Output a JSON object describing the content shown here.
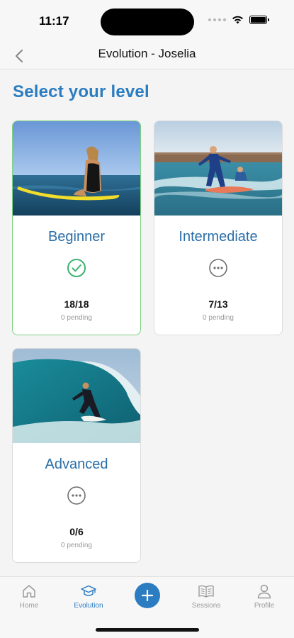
{
  "status_bar": {
    "time": "11:17"
  },
  "nav": {
    "title": "Evolution - Joselia",
    "back_icon": "chevron-left-icon"
  },
  "heading": "Select your level",
  "colors": {
    "accent": "#2b7cc1",
    "selected_border": "#7ed37e",
    "check_green": "#3cb371",
    "muted": "#9a9a9a"
  },
  "levels": [
    {
      "name": "Beginner",
      "progress": "18/18",
      "pending": "0 pending",
      "status_icon": "check-circle-icon",
      "selected": true,
      "completed_fraction": 1.0
    },
    {
      "name": "Intermediate",
      "progress": "7/13",
      "pending": "0 pending",
      "status_icon": "ellipsis-circle-icon",
      "selected": false,
      "completed_fraction": 0.54
    },
    {
      "name": "Advanced",
      "progress": "0/6",
      "pending": "0 pending",
      "status_icon": "ellipsis-circle-icon",
      "selected": false,
      "completed_fraction": 0.0
    }
  ],
  "tabs": [
    {
      "label": "Home",
      "icon": "home-icon",
      "active": false
    },
    {
      "label": "Evolution",
      "icon": "graduation-cap-icon",
      "active": true
    },
    {
      "label": "",
      "icon": "plus-icon",
      "active": false
    },
    {
      "label": "Sessions",
      "icon": "book-icon",
      "active": false
    },
    {
      "label": "Profile",
      "icon": "user-icon",
      "active": false
    }
  ]
}
